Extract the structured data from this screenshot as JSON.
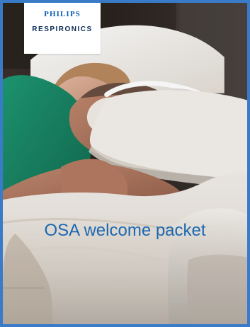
{
  "logo": {
    "brand": "PHILIPS",
    "product": "RESPIRONICS"
  },
  "cover": {
    "title": "OSA welcome packet"
  }
}
